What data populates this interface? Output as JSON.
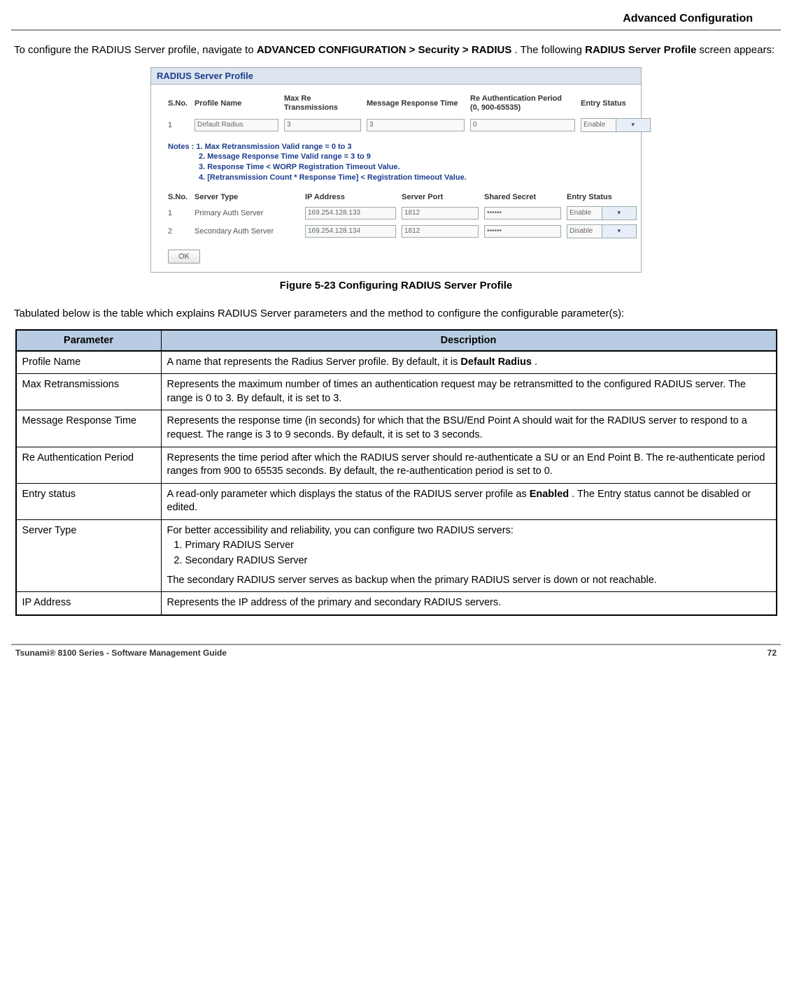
{
  "header": {
    "section_title": "Advanced Configuration"
  },
  "intro": {
    "pre": "To configure the RADIUS Server profile, navigate to ",
    "nav_path": "ADVANCED CONFIGURATION > Security > RADIUS",
    "post1": ". The following ",
    "screen_name": "RADIUS Server Profile",
    "post2": " screen appears:"
  },
  "screenshot": {
    "panel_title": "RADIUS Server Profile",
    "profile_headers": {
      "sno": "S.No.",
      "name": "Profile Name",
      "maxre": "Max Re Transmissions",
      "resp": "Message Response Time",
      "reauth_l1": "Re Authentication Period",
      "reauth_l2": "(0, 900-65535)",
      "status": "Entry Status"
    },
    "profile_row": {
      "sno": "1",
      "name": "Default Radius",
      "maxre": "3",
      "resp": "3",
      "reauth": "0",
      "status": "Enable"
    },
    "notes_label": "Notes :",
    "notes": [
      "1. Max Retransmission Valid range = 0 to 3",
      "2. Message Response Time Valid range = 3 to 9",
      "3. Response Time < WORP Registration Timeout Value.",
      "4. [Retransmission Count * Response Time] < Registration timeout Value."
    ],
    "server_headers": {
      "sno": "S.No.",
      "type": "Server Type",
      "ip": "IP Address",
      "port": "Server Port",
      "secret": "Shared Secret",
      "status": "Entry Status"
    },
    "server_rows": [
      {
        "sno": "1",
        "type": "Primary Auth Server",
        "ip": "169.254.128.133",
        "port": "1812",
        "secret": "******",
        "status": "Enable"
      },
      {
        "sno": "2",
        "type": "Secondary Auth Server",
        "ip": "169.254.128.134",
        "port": "1812",
        "secret": "******",
        "status": "Disable"
      }
    ],
    "ok_label": "OK"
  },
  "figure_caption": "Figure 5-23 Configuring RADIUS Server Profile",
  "tabulated_text": "Tabulated below is the table which explains RADIUS Server parameters and the method to configure the configurable parameter(s):",
  "param_table": {
    "headers": {
      "param": "Parameter",
      "desc": "Description"
    },
    "rows": [
      {
        "param": "Profile Name",
        "desc_pre": "A name that represents the Radius Server profile. By default, it is ",
        "desc_bold": "Default Radius",
        "desc_post": "."
      },
      {
        "param": "Max Retransmissions",
        "desc": "Represents the maximum number of times an authentication request may be retransmitted to the configured RADIUS server. The range is 0 to 3. By default, it is set to 3."
      },
      {
        "param": "Message Response Time",
        "desc": "Represents the response time (in seconds) for which that the BSU/End Point A should wait for the RADIUS server to respond to a request. The range is 3 to 9 seconds. By default, it is set to 3 seconds."
      },
      {
        "param": "Re Authentication Period",
        "desc": "Represents the time period after which the RADIUS server should re-authenticate a SU or an End Point B. The re-authenticate period ranges from 900 to 65535 seconds. By default, the re-authentication period is set to 0."
      },
      {
        "param": "Entry status",
        "desc_pre": "A read-only parameter which displays the status of the RADIUS server profile as ",
        "desc_bold": "Enabled",
        "desc_post": ". The Entry status cannot be disabled or edited."
      },
      {
        "param": "Server Type",
        "desc_intro": "For better accessibility and reliability, you can configure two RADIUS servers:",
        "list": [
          "Primary RADIUS Server",
          "Secondary RADIUS Server"
        ],
        "desc_outro": "The secondary RADIUS server serves as backup when the primary RADIUS server is down or not reachable."
      },
      {
        "param": "IP Address",
        "desc": "Represents the IP address of the primary and secondary RADIUS servers."
      }
    ]
  },
  "footer": {
    "left": "Tsunami® 8100 Series - Software Management Guide",
    "right": "72"
  },
  "chart_data": {
    "type": "table",
    "title": "RADIUS Server parameter descriptions",
    "columns": [
      "Parameter",
      "Description"
    ],
    "rows": [
      [
        "Profile Name",
        "A name that represents the Radius Server profile. By default, it is Default Radius."
      ],
      [
        "Max Retransmissions",
        "Represents the maximum number of times an authentication request may be retransmitted to the configured RADIUS server. The range is 0 to 3. By default, it is set to 3."
      ],
      [
        "Message Response Time",
        "Represents the response time (in seconds) for which that the BSU/End Point A should wait for the RADIUS server to respond to a request. The range is 3 to 9 seconds. By default, it is set to 3 seconds."
      ],
      [
        "Re Authentication Period",
        "Represents the time period after which the RADIUS server should re-authenticate a SU or an End Point B. The re-authenticate period ranges from 900 to 65535 seconds. By default, the re-authentication period is set to 0."
      ],
      [
        "Entry status",
        "A read-only parameter which displays the status of the RADIUS server profile as Enabled. The Entry status cannot be disabled or edited."
      ],
      [
        "Server Type",
        "For better accessibility and reliability, you can configure two RADIUS servers: 1. Primary RADIUS Server 2. Secondary RADIUS Server. The secondary RADIUS server serves as backup when the primary RADIUS server is down or not reachable."
      ],
      [
        "IP Address",
        "Represents the IP address of the primary and secondary RADIUS servers."
      ]
    ]
  }
}
